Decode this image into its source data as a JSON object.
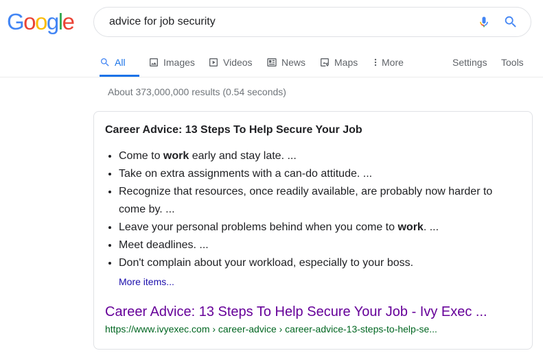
{
  "logo": {
    "letters": [
      {
        "ch": "G",
        "color": "#4285F4"
      },
      {
        "ch": "o",
        "color": "#EA4335"
      },
      {
        "ch": "o",
        "color": "#FBBC05"
      },
      {
        "ch": "g",
        "color": "#4285F4"
      },
      {
        "ch": "l",
        "color": "#34A853"
      },
      {
        "ch": "e",
        "color": "#EA4335"
      }
    ]
  },
  "search": {
    "query": "advice for job security"
  },
  "tabs": {
    "all": "All",
    "images": "Images",
    "videos": "Videos",
    "news": "News",
    "maps": "Maps",
    "more": "More",
    "settings": "Settings",
    "tools": "Tools"
  },
  "stats": "About 373,000,000 results (0.54 seconds)",
  "snippet": {
    "title": "Career Advice: 13 Steps To Help Secure Your Job",
    "bullets": [
      {
        "before": "Come to ",
        "bold": "work",
        "after": " early and stay late. ..."
      },
      {
        "before": "Take on extra assignments with a can-do attitude. ...",
        "bold": "",
        "after": ""
      },
      {
        "before": "Recognize that resources, once readily available, are probably now harder to come by. ...",
        "bold": "",
        "after": ""
      },
      {
        "before": "Leave your personal problems behind when you come to ",
        "bold": "work",
        "after": ". ..."
      },
      {
        "before": "Meet deadlines. ...",
        "bold": "",
        "after": ""
      },
      {
        "before": "Don't complain about your workload, especially to your boss.",
        "bold": "",
        "after": ""
      }
    ],
    "more_items": "More items...",
    "result_title": "Career Advice: 13 Steps To Help Secure Your Job - Ivy Exec ...",
    "result_url": "https://www.ivyexec.com › career-advice › career-advice-13-steps-to-help-se..."
  },
  "colors": {
    "accent": "#1a73e8",
    "visited_link": "#660099",
    "url_green": "#006621"
  }
}
